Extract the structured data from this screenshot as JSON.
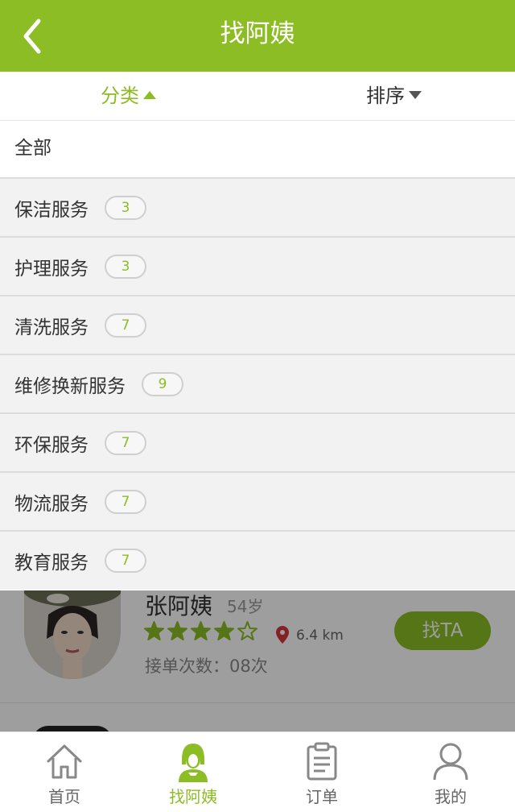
{
  "header": {
    "title": "找阿姨"
  },
  "filter": {
    "category_label": "分类",
    "sort_label": "排序"
  },
  "dropdown": {
    "all_label": "全部",
    "items": [
      {
        "label": "保洁服务",
        "count": "3"
      },
      {
        "label": "护理服务",
        "count": "3"
      },
      {
        "label": "清洗服务",
        "count": "7"
      },
      {
        "label": "维修换新服务",
        "count": "9"
      },
      {
        "label": "环保服务",
        "count": "7"
      },
      {
        "label": "物流服务",
        "count": "7"
      },
      {
        "label": "教育服务",
        "count": "7"
      }
    ]
  },
  "worker": {
    "name": "张阿姨",
    "age": "54岁",
    "rating": 4,
    "rating_max": 5,
    "distance": "6.4 km",
    "orders": "接单次数：08次",
    "action_label": "找TA"
  },
  "tabbar": [
    {
      "label": "首页",
      "icon": "home-icon"
    },
    {
      "label": "找阿姨",
      "icon": "nanny-icon"
    },
    {
      "label": "订单",
      "icon": "clipboard-icon"
    },
    {
      "label": "我的",
      "icon": "user-icon"
    }
  ],
  "colors": {
    "brand": "#8cbd24",
    "location_pin": "#d9343f"
  }
}
